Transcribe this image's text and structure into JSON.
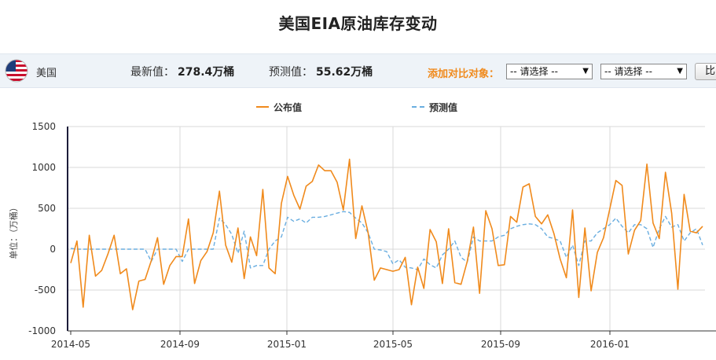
{
  "page_title": "美国EIA原油库存变动",
  "infobar": {
    "country": "美国",
    "latest_label": "最新值：",
    "latest_value": "278.4万桶",
    "forecast_label": "预测值：",
    "forecast_value": "55.62万桶",
    "compare_label": "添加对比对象：",
    "select1": "-- 请选择 --",
    "select2": "-- 请选择 --",
    "compare_button": "比"
  },
  "colors": {
    "actual": "#f08a1c",
    "forecast": "#6aaee0",
    "infobar_bg": "#eef3f8"
  },
  "chart_data": {
    "type": "line",
    "ylabel": "单位：（万桶）",
    "ylim": [
      -1000,
      1500
    ],
    "yticks": [
      "1500",
      "1000",
      "500",
      "0",
      "-500",
      "-1000"
    ],
    "xticks": [
      "2014-05",
      "2014-09",
      "2015-01",
      "2015-05",
      "2015-09",
      "2016-01"
    ],
    "grid": true,
    "legend_position": "top-center",
    "series": [
      {
        "name": "公布值",
        "values": [
          -170,
          100,
          -710,
          170,
          -330,
          -260,
          -60,
          170,
          -300,
          -240,
          -740,
          -390,
          -370,
          -140,
          140,
          -430,
          -200,
          -90,
          -90,
          370,
          -420,
          -140,
          -30,
          200,
          710,
          50,
          -160,
          260,
          -360,
          150,
          -80,
          730,
          -230,
          -300,
          560,
          890,
          660,
          490,
          770,
          830,
          1030,
          960,
          960,
          820,
          480,
          1100,
          130,
          530,
          200,
          -380,
          -230,
          -250,
          -270,
          -250,
          -100,
          -680,
          -220,
          -480,
          240,
          90,
          -420,
          250,
          -410,
          -430,
          -150,
          270,
          -540,
          470,
          250,
          -200,
          -190,
          400,
          330,
          760,
          800,
          400,
          310,
          420,
          190,
          -120,
          -350,
          480,
          -590,
          260,
          -510,
          -40,
          140,
          490,
          840,
          780,
          -60,
          230,
          350,
          1040,
          320,
          130,
          940,
          440,
          -490,
          670,
          220,
          200,
          280
        ]
      },
      {
        "name": "预测值",
        "values": [
          10,
          0,
          0,
          0,
          0,
          0,
          0,
          0,
          0,
          0,
          0,
          0,
          0,
          -150,
          0,
          0,
          0,
          0,
          -150,
          0,
          0,
          0,
          0,
          0,
          380,
          300,
          180,
          -50,
          220,
          -230,
          -200,
          -200,
          0,
          100,
          150,
          390,
          340,
          370,
          320,
          390,
          390,
          400,
          420,
          440,
          460,
          450,
          380,
          320,
          200,
          0,
          -10,
          -30,
          -180,
          -130,
          -220,
          -230,
          -250,
          -120,
          -190,
          -230,
          -70,
          0,
          100,
          -100,
          -160,
          150,
          100,
          100,
          100,
          150,
          170,
          250,
          280,
          300,
          310,
          300,
          250,
          150,
          130,
          100,
          -100,
          50,
          -200,
          100,
          100,
          200,
          250,
          300,
          380,
          280,
          200,
          300,
          300,
          250,
          20,
          250,
          400,
          270,
          300,
          100,
          200,
          250,
          50
        ]
      }
    ]
  }
}
